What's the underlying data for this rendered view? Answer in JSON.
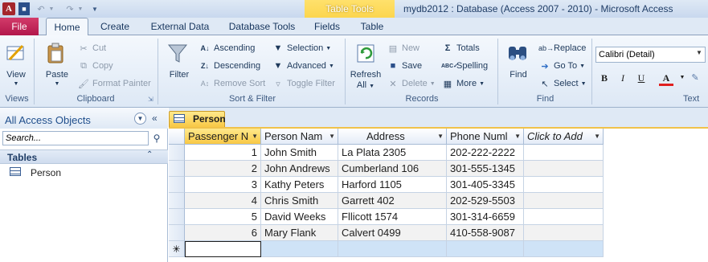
{
  "titlebar": {
    "app_icon": "A",
    "window_title": "mydb2012 : Database (Access 2007 - 2010)  -  Microsoft Access",
    "contextual_title": "Table Tools",
    "qat_icons": [
      "access-app-icon",
      "save-icon",
      "undo-icon",
      "redo-icon",
      "customize-qat-icon"
    ]
  },
  "tabs": {
    "file": "File",
    "home": "Home",
    "create": "Create",
    "external": "External Data",
    "dbtools": "Database Tools",
    "fields": "Fields",
    "table": "Table"
  },
  "ribbon": {
    "views": {
      "label": "Views",
      "view_button": "View"
    },
    "clipboard": {
      "label": "Clipboard",
      "paste": "Paste",
      "cut": "Cut",
      "copy": "Copy",
      "format_painter": "Format Painter"
    },
    "sort_filter": {
      "label": "Sort & Filter",
      "filter": "Filter",
      "ascending": "Ascending",
      "descending": "Descending",
      "remove_sort": "Remove Sort",
      "selection": "Selection",
      "advanced": "Advanced",
      "toggle_filter": "Toggle Filter"
    },
    "records": {
      "label": "Records",
      "refresh_line1": "Refresh",
      "refresh_line2": "All",
      "new": "New",
      "save": "Save",
      "delete": "Delete",
      "totals": "Totals",
      "spelling": "Spelling",
      "more": "More"
    },
    "find": {
      "label": "Find",
      "find": "Find",
      "replace": "Replace",
      "goto": "Go To",
      "select": "Select"
    },
    "text": {
      "label": "Text",
      "font": "Calibri (Detail)",
      "bold": "B",
      "italic": "I",
      "underline": "U",
      "font_color": "A"
    }
  },
  "nav": {
    "title": "All Access Objects",
    "search_placeholder": "Search...",
    "group_label": "Tables",
    "items": [
      {
        "label": "Person",
        "icon": "table-icon"
      }
    ]
  },
  "document": {
    "tab_label": "Person",
    "columns": [
      "Passenger N",
      "Person Nam",
      "Address",
      "Phone Numl",
      "Click to Add"
    ],
    "rows": [
      {
        "id": "1",
        "name": "John Smith",
        "address": "La Plata 2305",
        "phone": "202-222-2222"
      },
      {
        "id": "2",
        "name": "John Andrews",
        "address": "Cumberland 106",
        "phone": "301-555-1345"
      },
      {
        "id": "3",
        "name": "Kathy Peters",
        "address": "Harford 1105",
        "phone": "301-405-3345"
      },
      {
        "id": "4",
        "name": "Chris Smith",
        "address": "Garrett 402",
        "phone": "202-529-5503"
      },
      {
        "id": "5",
        "name": "David Weeks",
        "address": "Fllicott  1574",
        "phone": "301-314-6659"
      },
      {
        "id": "6",
        "name": "Mary Flank",
        "address": "Calvert 0499",
        "phone": "410-558-9087"
      }
    ],
    "new_row_marker": "✳"
  },
  "colors": {
    "file_tab": "#b2174b",
    "contextual_tab": "#fbd348",
    "ribbon_bg": "#dde8f5",
    "selected_header": "#f8c845",
    "new_row": "#cfe3f7"
  }
}
